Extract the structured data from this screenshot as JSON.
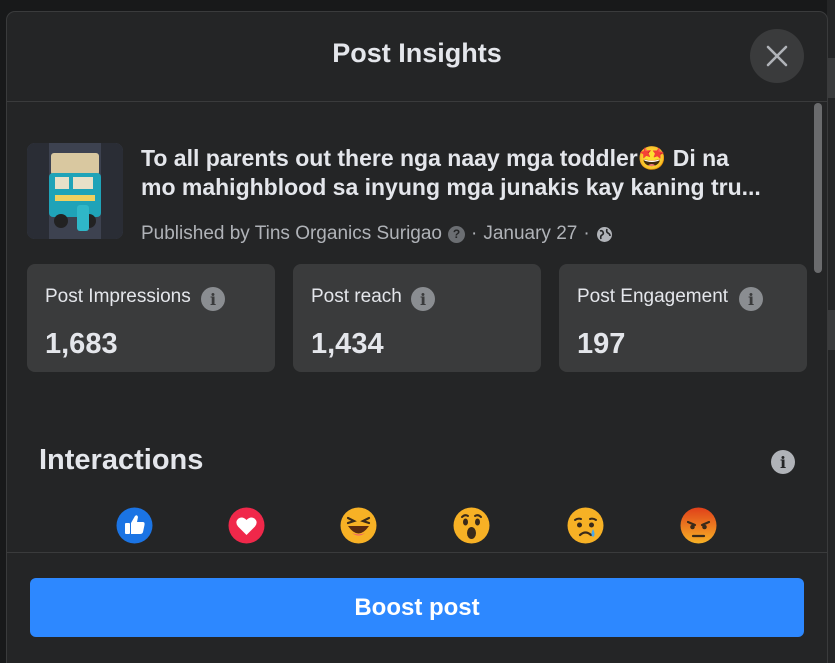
{
  "dialog": {
    "title": "Post Insights",
    "close_icon": "close-icon"
  },
  "post": {
    "text": "To all parents out there nga naay mga toddler🤩 Di na\nmo mahighblood sa inyung mga junakis kay kaning tru...",
    "publisher": "Published by Tins Organics Surigao",
    "date": "January 27",
    "separator": "·",
    "audience_icon": "globe-icon"
  },
  "stats": [
    {
      "label": "Post Impressions",
      "value": "1,683"
    },
    {
      "label": "Post reach",
      "value": "1,434"
    },
    {
      "label": "Post Engagement",
      "value": "197"
    }
  ],
  "interactions": {
    "title": "Interactions",
    "reactions": [
      "like-icon",
      "love-icon",
      "haha-icon",
      "wow-icon",
      "sad-icon",
      "angry-icon"
    ]
  },
  "footer": {
    "boost_label": "Boost post"
  },
  "colors": {
    "accent": "#2d88ff",
    "surface": "#242526",
    "card": "#3a3b3c"
  }
}
